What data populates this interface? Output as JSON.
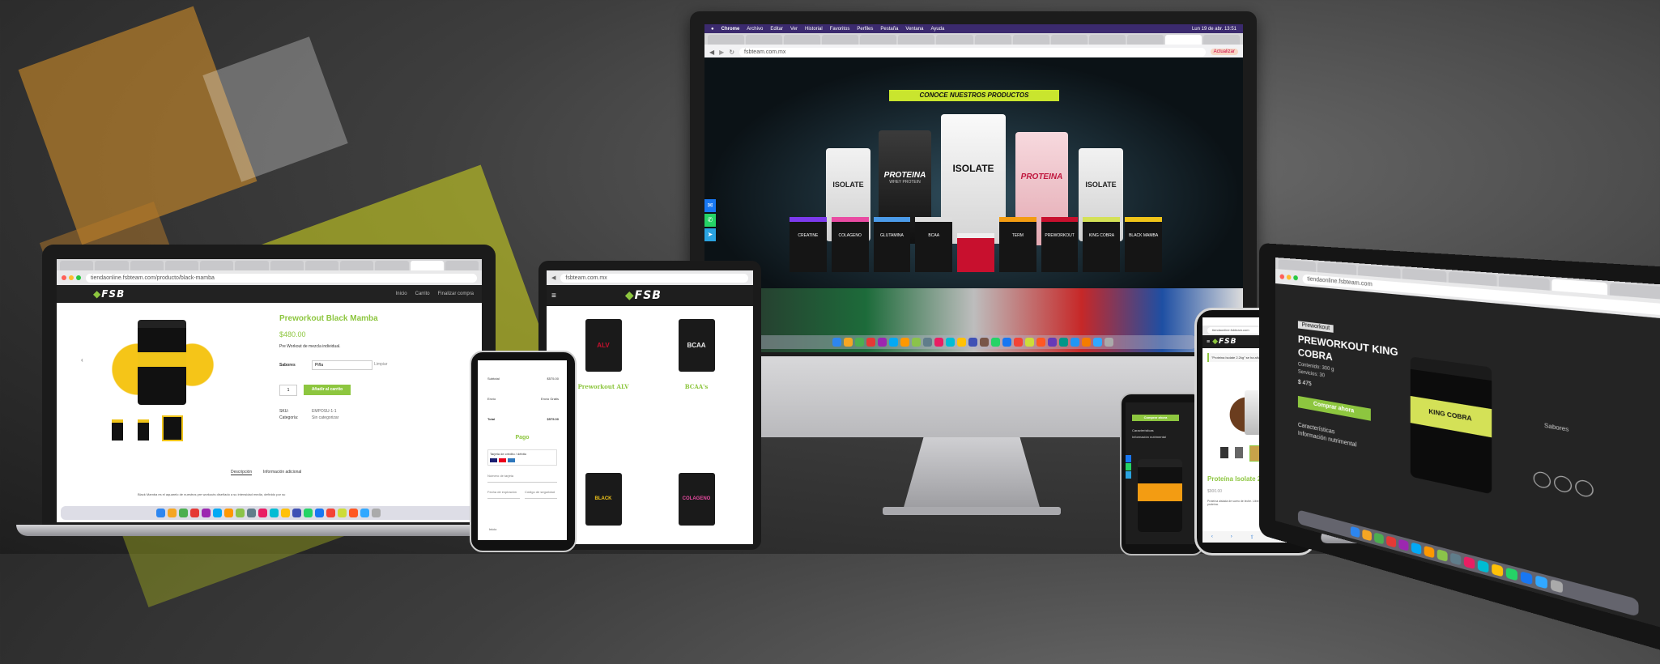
{
  "colors": {
    "brand_green": "#8dc63f",
    "banner_yellow": "#c9e52e",
    "dark": "#1a1a1a"
  },
  "imac": {
    "menubar": [
      "Chrome",
      "Archivo",
      "Editar",
      "Ver",
      "Historial",
      "Favoritos",
      "Perfiles",
      "Pestaña",
      "Ventana",
      "Ayuda"
    ],
    "clock": "Lun 19 de abr. 13:51",
    "url": "fsbteam.com.mx",
    "update_label": "Actualizar",
    "banner": "CONOCE NUESTROS PRODUCTOS",
    "products": [
      {
        "name": "ISOLATE",
        "color": "#e8e8e8"
      },
      {
        "name": "PROTEINA",
        "color": "#3a3a3a",
        "sub": "WHEY PROTEIN"
      },
      {
        "name": "ISOLATE",
        "color": "#f1f1f1"
      },
      {
        "name": "PROTEINA",
        "color": "#f3c9cf"
      },
      {
        "name": "ISOLATE",
        "color": "#e8e8e8"
      }
    ],
    "jars": [
      "CREATINE",
      "COLAGENO",
      "GLUTAMINA",
      "BCAA",
      "",
      "TERM",
      "PREWORKOUT",
      "KING COBRA",
      "BLACK MAMBA"
    ],
    "social": [
      "messenger-icon",
      "whatsapp-icon",
      "telegram-icon"
    ]
  },
  "laptop_left": {
    "url": "tiendaonline.fsbteam.com/producto/black-mamba",
    "logo": "FSB",
    "nav": [
      "Inicio",
      "Carrito",
      "Finalizar compra"
    ],
    "product_title": "Preworkout Black Mamba",
    "price": "$480.00",
    "short_desc": "Pre Workout de mezcla individual.",
    "flavor_label": "Sabores",
    "flavor_value": "Piña",
    "clear_label": "Limpiar",
    "qty": "1",
    "add_to_cart": "Añadir al carrito",
    "sku_label": "SKU:",
    "sku_value": "EMPOSU-1-1",
    "category_label": "Categoría:",
    "category_value": "Sin categorizar",
    "tabs": [
      "Descripción",
      "Información adicional"
    ],
    "footer_text": "Black Mamba es el aquarelo de nuestros pre workouts diseñado a su intensidad media, definido por su"
  },
  "tablet": {
    "url": "fsbteam.com.mx",
    "logo": "FSB",
    "products": [
      {
        "label": "Preworkout ALV",
        "jar": "#1a1a1a",
        "accent": "#c8102e",
        "art": "ALV"
      },
      {
        "label": "BCAA's",
        "jar": "#1a1a1a",
        "accent": "#eeeeee",
        "art": "BCAA"
      },
      {
        "label": "",
        "jar": "#1a1a1a",
        "accent": "#f0c419",
        "art": "BLACK MAMBA"
      },
      {
        "label": "",
        "jar": "#1a1a1a",
        "accent": "#e94ba2",
        "art": "COLAGENO"
      }
    ]
  },
  "phone_center": {
    "rows": [
      [
        "Subtotal",
        "$575.00"
      ],
      [
        "Envío",
        "Envío Gratis"
      ],
      [
        "Total",
        "$575.00"
      ]
    ],
    "pay_title": "Pago",
    "pay_option": "Tarjeta de crédito / débito",
    "fields": [
      "Número de tarjeta",
      "Fecha de expiración",
      "Código de seguridad"
    ],
    "footer": "Inicio"
  },
  "iphone": {
    "url": "tiendaonline.fsbteam.com",
    "logo": "FSB",
    "notice": "\"Proteina Isolate 2.2kg\" se ha añadido a tu carrito.",
    "product_title": "Proteína Isolate 2.2Kg",
    "price": "$900.00",
    "desc": "Proteína aislada de suero de leche. Libre de azúcar agregada. 90% proteína."
  },
  "small_phone": {
    "button": "Comprar ahora",
    "items": [
      "Características",
      "Información nutrimental"
    ]
  },
  "laptop_right": {
    "url": "tiendaonline.fsbteam.com",
    "badge": "Preworkout",
    "title_line1": "PREWORKOUT KING",
    "title_line2": "COBRA",
    "spec1": "Contenido: 300 g",
    "spec2": "Servicios: 30",
    "price": "$ 475",
    "cta": "Comprar ahora",
    "features": [
      "Características",
      "Información nutrimental"
    ],
    "side_label": "Sabores",
    "jar_art": "KING COBRA"
  }
}
